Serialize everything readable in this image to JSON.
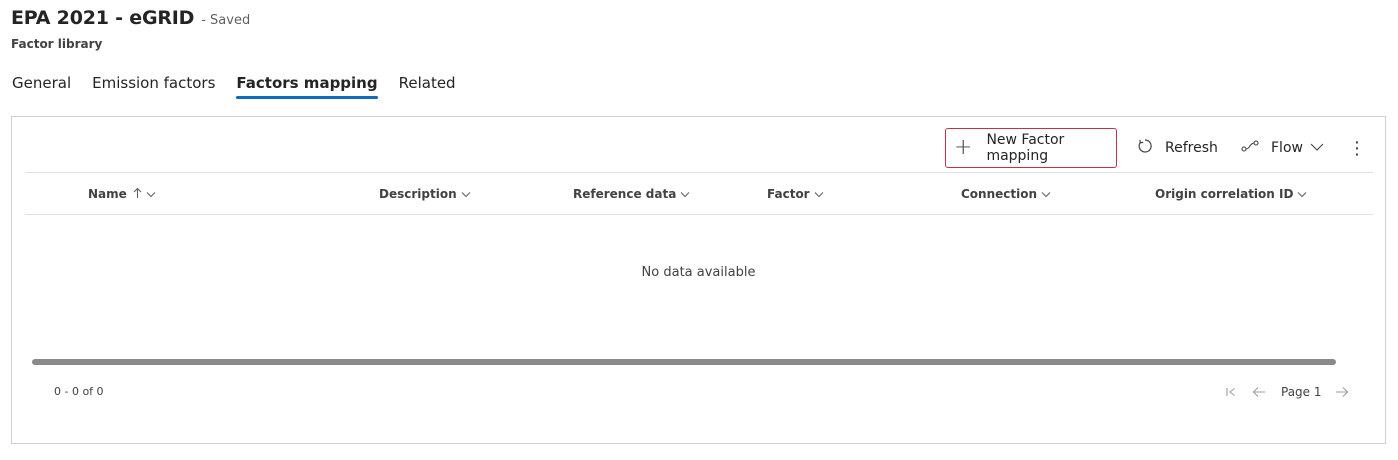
{
  "header": {
    "title": "EPA 2021 - eGRID",
    "status": "- Saved",
    "subtitle": "Factor library"
  },
  "tabs": [
    {
      "label": "General",
      "active": false
    },
    {
      "label": "Emission factors",
      "active": false
    },
    {
      "label": "Factors mapping",
      "active": true
    },
    {
      "label": "Related",
      "active": false
    }
  ],
  "commandbar": {
    "new_label": "New Factor mapping",
    "refresh_label": "Refresh",
    "flow_label": "Flow",
    "more_icon": "more-vertical-icon"
  },
  "grid": {
    "columns": [
      {
        "label": "Name",
        "sorted": "ascending"
      },
      {
        "label": "Description"
      },
      {
        "label": "Reference data"
      },
      {
        "label": "Factor"
      },
      {
        "label": "Connection"
      },
      {
        "label": "Origin correlation ID"
      }
    ],
    "empty_message": "No data available",
    "record_count": "0 - 0 of 0",
    "page_label": "Page 1"
  },
  "colors": {
    "accent": "#0f6cbd",
    "highlight_border": "#c4314b"
  }
}
